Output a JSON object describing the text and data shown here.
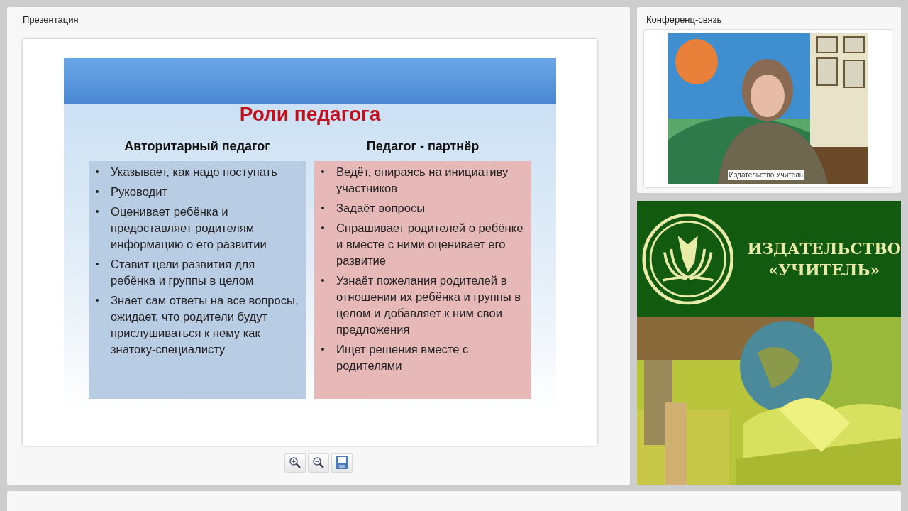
{
  "presentation": {
    "title": "Презентация",
    "slide": {
      "title": "Роли педагога",
      "columns": [
        {
          "heading": "Авторитарный педагог",
          "color": "#b8cce4",
          "items": [
            "Указывает, как надо поступать",
            "Руководит",
            "Оценивает ребёнка и предоставляет родителям информацию о его развитии",
            "Ставит цели развития для ребёнка и группы в целом",
            "Знает сам ответы на все вопросы, ожидает, что родители будут прислушиваться к нему как знатоку-специалисту"
          ]
        },
        {
          "heading": "Педагог - партнёр",
          "color": "#e6b9b8",
          "items": [
            "Ведёт, опираясь на инициативу участников",
            "Задаёт вопросы",
            "Спрашивает родителей о ребёнке и вместе с ними оценивает его развитие",
            "Узнаёт пожелания родителей в отношении их ребёнка и группы в целом и добавляет к ним свои предложения",
            "Ищет решения вместе с родителями"
          ]
        }
      ]
    },
    "toolbar": [
      {
        "kind": "zoom_in"
      },
      {
        "kind": "zoom_out"
      },
      {
        "kind": "save"
      }
    ]
  },
  "conference": {
    "title": "Конференц-связь",
    "video": {
      "kind": "picture",
      "caption": "Издательство Учитель"
    }
  },
  "banner": {
    "line1": "ИЗДАТЕЛЬСТВО",
    "line2": "«УЧИТЕЛЬ»"
  }
}
